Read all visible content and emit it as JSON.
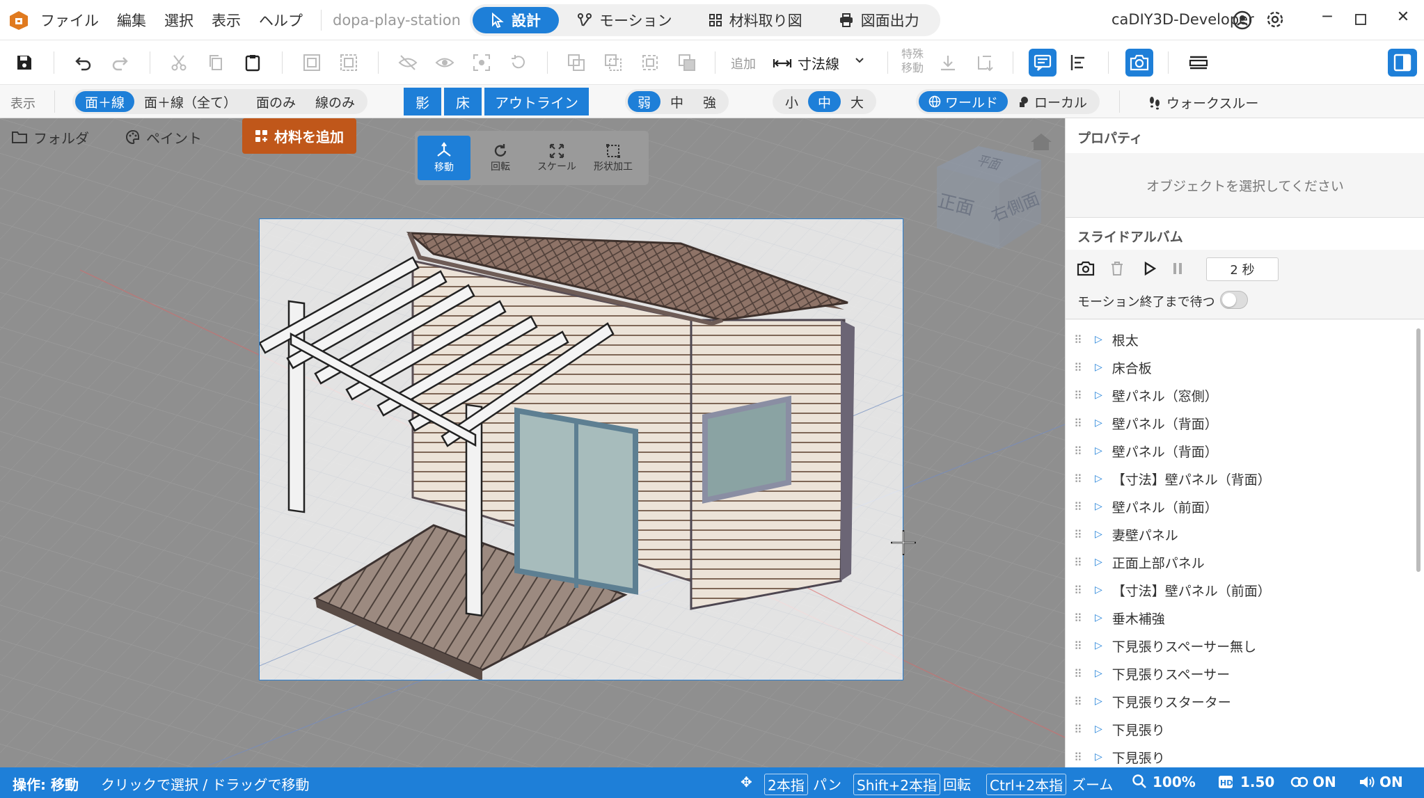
{
  "titlebar": {
    "menus": [
      "ファイル",
      "編集",
      "選択",
      "表示",
      "ヘルプ"
    ],
    "project_name": "dopa-play-station",
    "modes": [
      "設計",
      "モーション",
      "材料取り図",
      "図面出力"
    ],
    "active_mode": "設計",
    "user": "caDIY3D-Developer"
  },
  "toolbar": {
    "add_label": "追加",
    "dimension_label": "寸法線",
    "special_move_label": "特殊\n移動",
    "special_move_line1": "特殊",
    "special_move_line2": "移動"
  },
  "displaybar": {
    "label": "表示",
    "render_modes": [
      "面＋線",
      "面＋線（全て）",
      "面のみ",
      "線のみ"
    ],
    "toggles": [
      "影",
      "床",
      "アウトライン"
    ],
    "strength": [
      "弱",
      "中",
      "強"
    ],
    "size": [
      "小",
      "中",
      "大"
    ],
    "coords": [
      "ワールド",
      "ローカル"
    ],
    "walkthrough": "ウォークスルー"
  },
  "viewport": {
    "folder": "フォルダ",
    "paint": "ペイント",
    "add_material": "材料を追加",
    "transform_tools": [
      "移動",
      "回転",
      "スケール",
      "形状加工"
    ],
    "view_cube": {
      "top": "平面",
      "front": "正面",
      "right": "右側面"
    }
  },
  "properties": {
    "title": "プロパティ",
    "empty_message": "オブジェクトを選択してください"
  },
  "slide_album": {
    "title": "スライドアルバム",
    "interval": "2 秒",
    "wait_label": "モーション終了まで待つ",
    "wait_enabled": false
  },
  "tree": [
    "根太",
    "床合板",
    "壁パネル（窓側）",
    "壁パネル（背面）",
    "壁パネル（背面）",
    "【寸法】壁パネル（背面）",
    "壁パネル（前面）",
    "妻壁パネル",
    "正面上部パネル",
    "【寸法】壁パネル（前面）",
    "垂木補強",
    "下見張りスペーサー無し",
    "下見張りスペーサー",
    "下見張りスターター",
    "下見張り",
    "下見張り"
  ],
  "status": {
    "operation": "操作: 移動",
    "hint": "クリックで選択 / ドラッグで移動",
    "pan_key": "2本指",
    "pan_label": "パン",
    "rotate_key": "Shift+2本指",
    "rotate_label": "回転",
    "zoom_key": "Ctrl+2本指",
    "zoom_label": "ズーム",
    "zoom_level": "100%",
    "hd_value": "1.50",
    "link_state": "ON",
    "sound_state": "ON"
  },
  "colors": {
    "accent": "#1e7fd8",
    "add_material": "#c0571a",
    "viewport_bg": "#8f8f8f"
  }
}
